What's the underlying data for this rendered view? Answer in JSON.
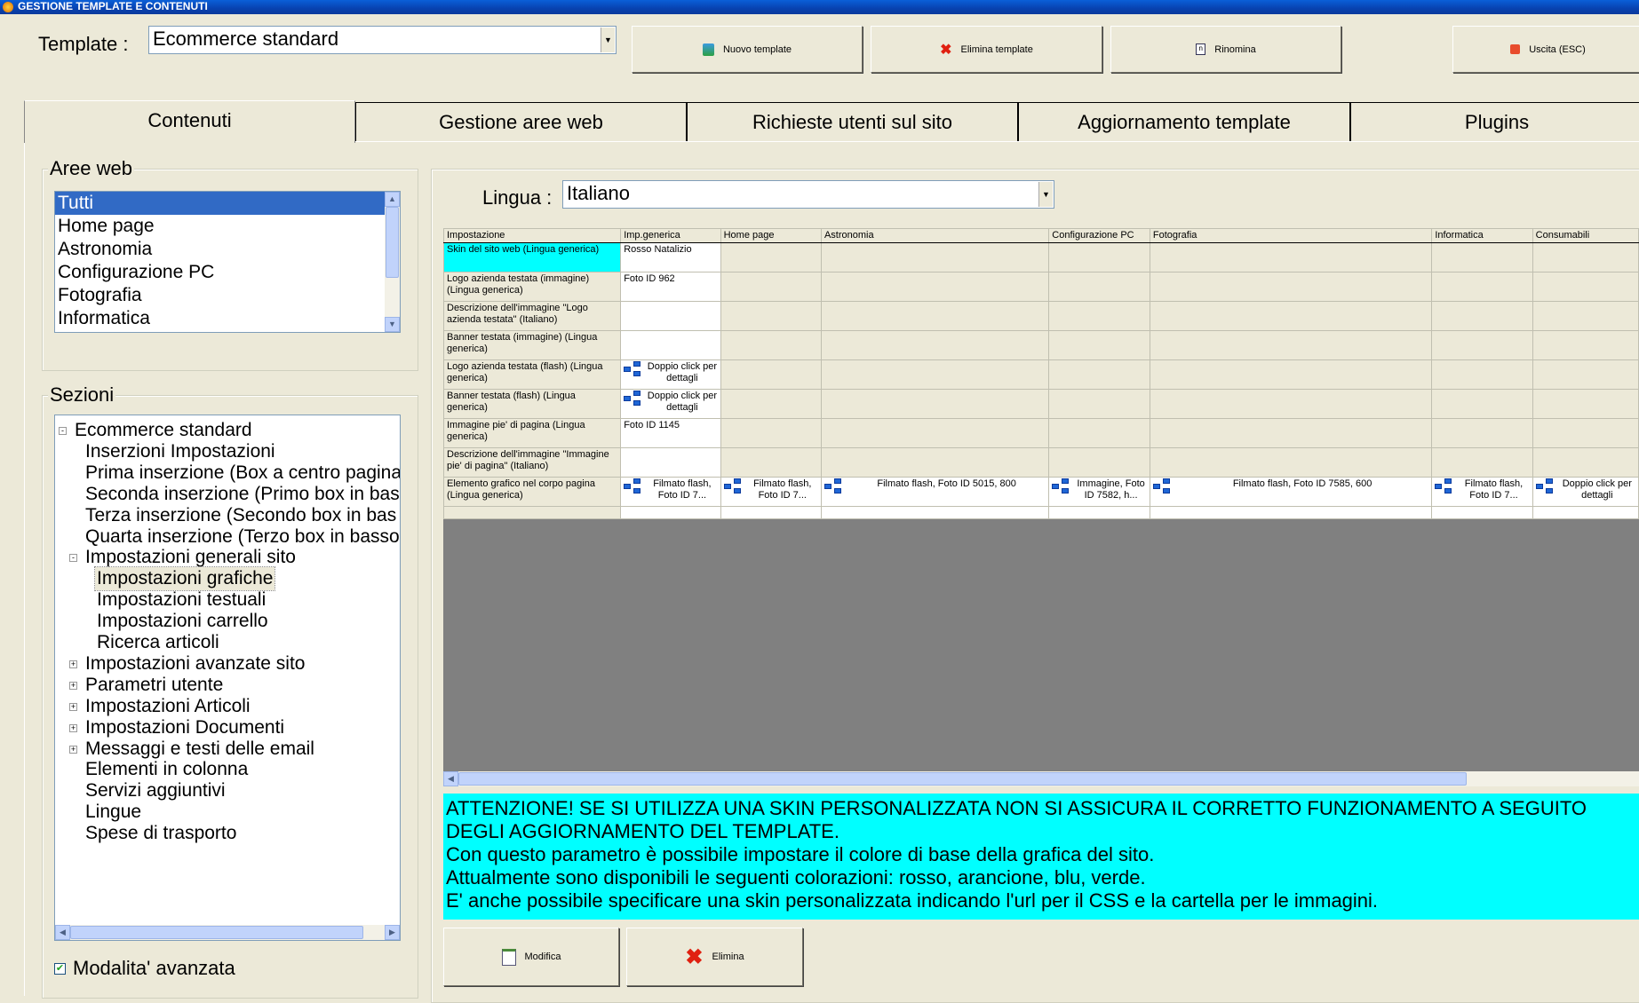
{
  "window": {
    "title": "GESTIONE TEMPLATE E CONTENUTI"
  },
  "toolbar": {
    "template_label": "Template :",
    "template_value": "Ecommerce standard",
    "new_template": "Nuovo template",
    "delete_template": "Elimina template",
    "rename": "Rinomina",
    "exit": "Uscita (ESC)"
  },
  "tabs": [
    "Contenuti",
    "Gestione aree web",
    "Richieste utenti sul sito",
    "Aggiornamento template",
    "Plugins"
  ],
  "aree_web": {
    "title": "Aree web",
    "items": [
      "Tutti",
      "Home page",
      "Astronomia",
      "Configurazione PC",
      "Fotografia",
      "Informatica"
    ],
    "selected": 0
  },
  "sezioni": {
    "title": "Sezioni",
    "items": [
      {
        "label": "Ecommerce standard",
        "level": 0,
        "exp": "-"
      },
      {
        "label": "Inserzioni Impostazioni",
        "level": 1
      },
      {
        "label": "Prima inserzione (Box a centro pagina",
        "level": 1
      },
      {
        "label": "Seconda inserzione (Primo box in bas",
        "level": 1
      },
      {
        "label": "Terza inserzione (Secondo box in bas",
        "level": 1
      },
      {
        "label": "Quarta inserzione (Terzo box in basso",
        "level": 1
      },
      {
        "label": "Impostazioni generali sito",
        "level": 1,
        "exp": "-"
      },
      {
        "label": "Impostazioni grafiche",
        "level": 2,
        "selected": true
      },
      {
        "label": "Impostazioni testuali",
        "level": 2
      },
      {
        "label": "Impostazioni carrello",
        "level": 2
      },
      {
        "label": "Ricerca articoli",
        "level": 2
      },
      {
        "label": "Impostazioni avanzate sito",
        "level": 1,
        "exp": "+"
      },
      {
        "label": "Parametri utente",
        "level": 1,
        "exp": "+"
      },
      {
        "label": "Impostazioni Articoli",
        "level": 1,
        "exp": "+"
      },
      {
        "label": "Impostazioni Documenti",
        "level": 1,
        "exp": "+"
      },
      {
        "label": "Messaggi e testi delle email",
        "level": 1,
        "exp": "+"
      },
      {
        "label": "Elementi in colonna",
        "level": 1
      },
      {
        "label": "Servizi aggiuntivi",
        "level": 1
      },
      {
        "label": "Lingue",
        "level": 1
      },
      {
        "label": "Spese di trasporto",
        "level": 1
      }
    ]
  },
  "advanced_mode": {
    "label": "Modalita' avanzata",
    "checked": true
  },
  "lingua": {
    "label": "Lingua :",
    "value": "Italiano"
  },
  "grid": {
    "columns": [
      "Impostazione",
      "Imp.generica",
      "Home page",
      "Astronomia",
      "Configurazione PC",
      "Fotografia",
      "Informatica",
      "Consumabili"
    ],
    "rows": [
      {
        "name": "Skin del sito web (Lingua generica)",
        "cells": [
          {
            "text": "Rosso Natalizio"
          },
          null,
          null,
          null,
          null,
          null,
          null
        ],
        "selected": true
      },
      {
        "name": "Logo azienda testata (immagine) (Lingua generica)",
        "cells": [
          {
            "text": "Foto ID 962"
          },
          null,
          null,
          null,
          null,
          null,
          null
        ]
      },
      {
        "name": "Descrizione dell'immagine \"Logo azienda testata\" (Italiano)",
        "cells": [
          {
            "text": ""
          },
          null,
          null,
          null,
          null,
          null,
          null
        ]
      },
      {
        "name": "Banner testata (immagine) (Lingua generica)",
        "cells": [
          {
            "text": ""
          },
          null,
          null,
          null,
          null,
          null,
          null
        ]
      },
      {
        "name": "Logo azienda testata (flash) (Lingua generica)",
        "cells": [
          {
            "text": "Doppio click per dettagli",
            "icon": true
          },
          null,
          null,
          null,
          null,
          null,
          null
        ]
      },
      {
        "name": "Banner testata (flash) (Lingua generica)",
        "cells": [
          {
            "text": "Doppio click per dettagli",
            "icon": true
          },
          null,
          null,
          null,
          null,
          null,
          null
        ]
      },
      {
        "name": "Immagine pie' di pagina (Lingua generica)",
        "cells": [
          {
            "text": "Foto ID 1145"
          },
          null,
          null,
          null,
          null,
          null,
          null
        ]
      },
      {
        "name": "Descrizione dell'immagine \"Immagine pie' di pagina\" (Italiano)",
        "cells": [
          {
            "text": ""
          },
          null,
          null,
          null,
          null,
          null,
          null
        ]
      },
      {
        "name": "Elemento grafico nel corpo pagina (Lingua generica)",
        "cells": [
          {
            "text": "Filmato flash, Foto ID 7...",
            "icon": true
          },
          {
            "text": "Filmato flash, Foto ID 7...",
            "icon": true
          },
          {
            "text": "Filmato flash, Foto ID 5015, 800",
            "icon": true
          },
          {
            "text": "Immagine, Foto ID 7582, h...",
            "icon": true
          },
          {
            "text": "Filmato flash, Foto ID 7585, 600",
            "icon": true
          },
          {
            "text": "Filmato flash, Foto ID 7...",
            "icon": true
          },
          {
            "text": "Doppio click per dettagli",
            "icon": true
          }
        ]
      }
    ]
  },
  "info": {
    "lines": [
      "ATTENZIONE! SE SI UTILIZZA UNA SKIN PERSONALIZZATA NON SI ASSICURA IL CORRETTO FUNZIONAMENTO A SEGUITO",
      "DEGLI AGGIORNAMENTO DEL TEMPLATE.",
      "Con questo parametro è possibile impostare il colore di base della grafica del sito.",
      "Attualmente sono disponibili le seguenti colorazioni: rosso, arancione, blu, verde.",
      "E' anche possibile specificare una skin personalizzata indicando l'url per il CSS e la cartella per le immagini."
    ]
  },
  "actions": {
    "modify": "Modifica",
    "delete": "Elimina"
  },
  "colors": {
    "selection": "#316ac5",
    "highlight": "#00ffff",
    "background": "#ece9d8",
    "grid_empty": "#808080"
  }
}
